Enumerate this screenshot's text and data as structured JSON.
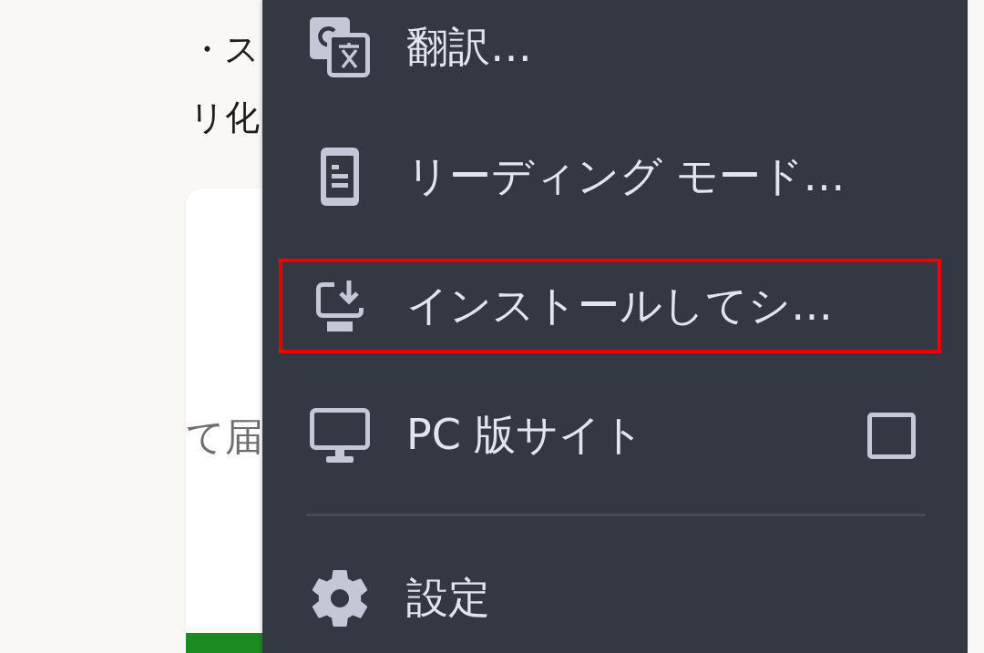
{
  "page": {
    "lines": [
      "・ス",
      "リ化"
    ],
    "card": {
      "text": "て届"
    }
  },
  "menu": {
    "groups": [
      [
        {
          "kind": "action",
          "label": "翻訳…",
          "highlighted": false
        },
        {
          "kind": "action",
          "label": "リーディング モード…",
          "highlighted": false
        },
        {
          "kind": "action",
          "label": "インストールしてシ…",
          "highlighted": true
        },
        {
          "kind": "checkbox",
          "label": "PC 版サイト",
          "checked": false,
          "highlighted": false
        }
      ],
      [
        {
          "kind": "action",
          "label": "設定",
          "highlighted": false
        }
      ]
    ]
  }
}
